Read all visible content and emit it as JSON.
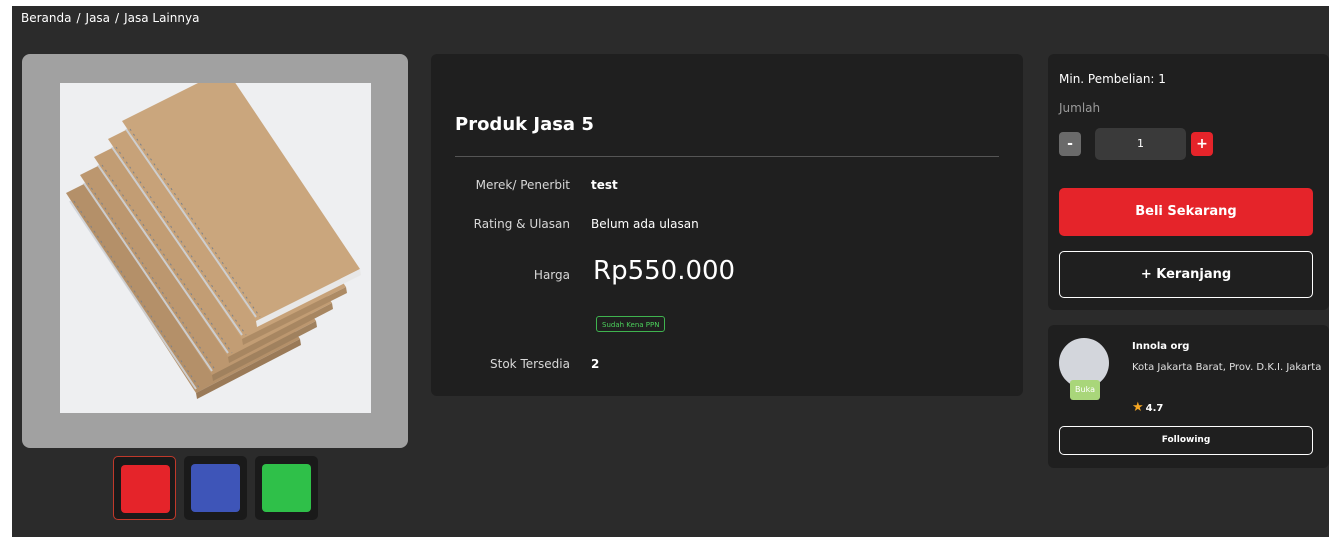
{
  "breadcrumb": [
    "Beranda",
    "Jasa",
    "Jasa Lainnya"
  ],
  "breadcrumb_separator": "/",
  "product": {
    "title": "Produk Jasa 5",
    "brand_label": "Merek/ Penerbit",
    "brand_value": "test",
    "rating_label": "Rating & Ulasan",
    "rating_value": "Belum ada ulasan",
    "price_label": "Harga",
    "price_value": "Rp550.000",
    "tax_badge": "Sudah Kena PPN",
    "stock_label": "Stok Tersedia",
    "stock_value": "2"
  },
  "thumbnails": [
    {
      "color": "#e5242a",
      "active": true
    },
    {
      "color": "#3e55b8",
      "active": false
    },
    {
      "color": "#2fc049",
      "active": false
    }
  ],
  "purchase": {
    "min_purchase": "Min. Pembelian: 1",
    "qty_label": "Jumlah",
    "qty_minus": "-",
    "qty_value": "1",
    "qty_plus": "+",
    "buy_now": "Beli Sekarang",
    "add_to_cart": "+ Keranjang"
  },
  "seller": {
    "status_badge": "Buka",
    "name": "Innola org",
    "location": "Kota Jakarta Barat, Prov. D.K.I. Jakarta",
    "rating": "4.7",
    "follow_button": "Following"
  },
  "colors": {
    "page_bg": "#2b2b2b",
    "card_bg": "#1f1f1f",
    "accent_red": "#e5242a",
    "ppn_green": "#3fb34f",
    "open_green": "#a9d67a"
  },
  "icons": {
    "rating": "star-icon"
  }
}
